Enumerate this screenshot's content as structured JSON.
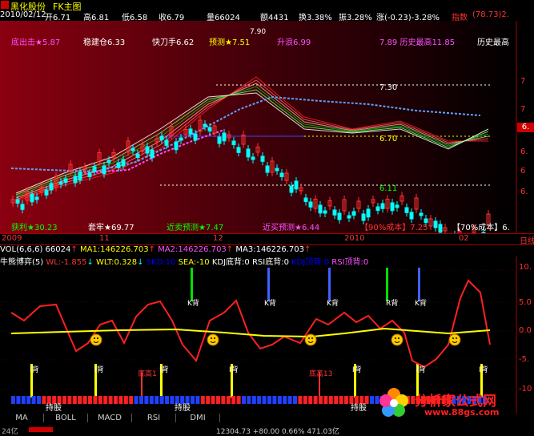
{
  "header": {
    "stock_name": "黑化股份",
    "chart_mode": "FK主图",
    "date": "2010/02/12",
    "open": "开6.71",
    "high": "高6.81",
    "low": "低6.58",
    "close": "收6.79",
    "volume": "量66024",
    "amount": "额4431",
    "turnover": "换3.38%",
    "amplitude": "振3.28%",
    "change": "涨(-0.23)-3.28%",
    "index_label": "指数",
    "index_value": "(78.73)2."
  },
  "main_labels": {
    "bottom_attack": "底出击★5.87",
    "steady_position": "稳建仓6.33",
    "quick_knife": "快刀手6.62",
    "forecast": "预测★7.51",
    "rise_cross": "升浪6.99",
    "history_high": "7.89 历史最高11.85",
    "history_high_right": "历史最高",
    "profit": "获利★30.23",
    "trapped": "套牢★69.77",
    "near_sell": "近卖预测★7.47",
    "near_buy": "近买预测★6.44",
    "cost90": "【90%成本】7.25",
    "cost70": "【70%成本】6.",
    "level_730": "7.30",
    "level_670": "6.70",
    "level_611": "6.11",
    "level_790": "7.90"
  },
  "price_axis": {
    "ticks": [
      "7",
      "7",
      "6.",
      "6",
      "6."
    ],
    "current": "6."
  },
  "date_axis": {
    "labels": [
      "2009",
      "11",
      "12",
      "2010",
      "02"
    ],
    "right": "日线"
  },
  "volume_line": {
    "vol": "VOL(6,6,6)",
    "vol_value": "66024",
    "ma1": "MA1:146226.703",
    "ma2": "MA2:146226.703",
    "ma3": "MA3:146226.703"
  },
  "indicator": {
    "name": "牛熊博弈(5)",
    "wl": "WL:-1.855",
    "wlt": "WLT:0.328",
    "skd": "SKD:10",
    "sea": "SEA:-10",
    "kdj_bottom": "KDJ底背:0",
    "rsi_bottom": "RSI底背:0",
    "kdj_top": "KDJ顶背:0",
    "rsi_top": "RSI顶背:0",
    "k_top_label": "K背",
    "r_top_label": "R背",
    "i_bottom_label": "I背",
    "bottom_high_label": "底高1",
    "bottom_high13": "底高13",
    "bottom_label": "底",
    "hold_label": "持股",
    "hold_label2": "持股",
    "hold_label3": "持股",
    "axis_ticks": [
      "10.",
      "5.0",
      "0.0",
      "-5.",
      "-10"
    ]
  },
  "tabs": [
    "MA",
    "BOLL",
    "MACD",
    "RSI",
    "DMI"
  ],
  "status": {
    "left": "24亿",
    "mid": "12304.73  +80.00  0.66%  471.03亿"
  },
  "logo": {
    "brand": "分析家公式网",
    "url": "www.88gs.com"
  },
  "colors": {
    "up": "#ff3232",
    "down": "#00ffff",
    "yellow": "#ffff00",
    "magenta": "#ff50ff",
    "green": "#00e000"
  }
}
